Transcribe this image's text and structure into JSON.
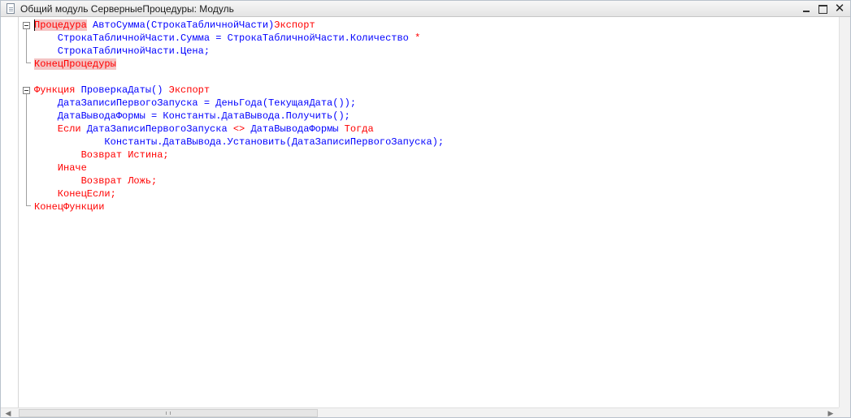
{
  "window": {
    "title": "Общий модуль СерверныеПроцедуры: Модуль",
    "icons": {
      "doc": "document-icon",
      "minimize": "minimize-icon",
      "maximize": "maximize-icon",
      "close": "close-icon"
    },
    "close_glyph": "✕"
  },
  "colors": {
    "keyword": "#ff0000",
    "identifier": "#0000ff",
    "highlight": "#f4c4c4"
  },
  "code": {
    "l1": {
      "kw1": "Процедура",
      "name": " АвтоСумма(СтрокаТабличнойЧасти)",
      "kw2": "Экспорт"
    },
    "l2": {
      "text": "    СтрокаТабличнойЧасти.Сумма = СтрокаТабличнойЧасти.Количество ",
      "op": "*"
    },
    "l3": {
      "text": "    СтрокаТабличнойЧасти.Цена;"
    },
    "l4": {
      "kw": "КонецПроцедуры"
    },
    "l6": {
      "kw1": "Функция",
      "name": " ПроверкаДаты() ",
      "kw2": "Экспорт"
    },
    "l7": {
      "text": "    ДатаЗаписиПервогоЗапуска = ДеньГода(ТекущаяДата());"
    },
    "l8": {
      "text": "    ДатаВыводаФормы = Константы.ДатаВывода.Получить();"
    },
    "l9": {
      "kw1": "    Если",
      "text1": " ДатаЗаписиПервогоЗапуска ",
      "op": "<>",
      "text2": " ДатаВыводаФормы ",
      "kw2": "Тогда"
    },
    "l10": {
      "text": "            Константы.ДатаВывода.Установить(ДатаЗаписиПервогоЗапуска);"
    },
    "l11": {
      "kw": "        Возврат Истина;"
    },
    "l12": {
      "kw": "    Иначе"
    },
    "l13": {
      "kw": "        Возврат Ложь;"
    },
    "l14": {
      "kw": "    КонецЕсли;"
    },
    "l15": {
      "kw": "КонецФункции"
    }
  },
  "scroll": {
    "left_glyph": "◀",
    "right_glyph": "▶"
  }
}
